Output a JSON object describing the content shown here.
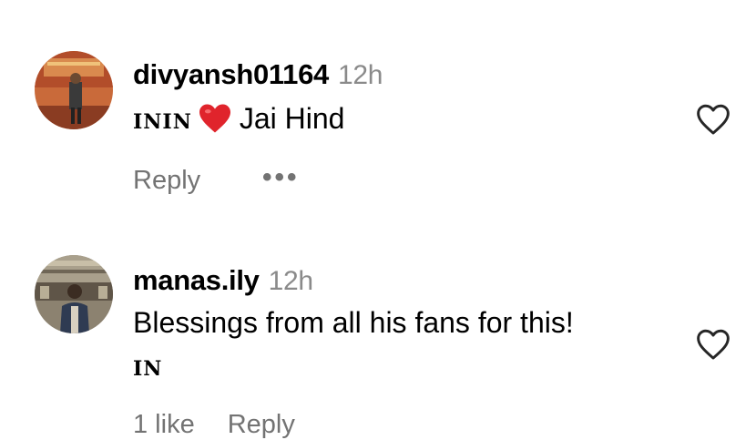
{
  "comments": [
    {
      "username": "divyansh01164",
      "time": "12h",
      "flag_label": "ININ",
      "emoji": "heart",
      "text": "Jai Hind",
      "reply_label": "Reply",
      "more_label": "•••"
    },
    {
      "username": "manas.ily",
      "time": "12h",
      "text": "Blessings from all his fans for this!",
      "flag_label": "IN",
      "likes_label": "1 like",
      "reply_label": "Reply"
    }
  ],
  "colors": {
    "secondary_text": "#737373",
    "heart_emoji": "#e0242c",
    "like_outline": "#262626"
  },
  "icons": {
    "like": "heart-outline-icon",
    "emoji": "red-heart-icon",
    "more": "more-horizontal-icon"
  }
}
